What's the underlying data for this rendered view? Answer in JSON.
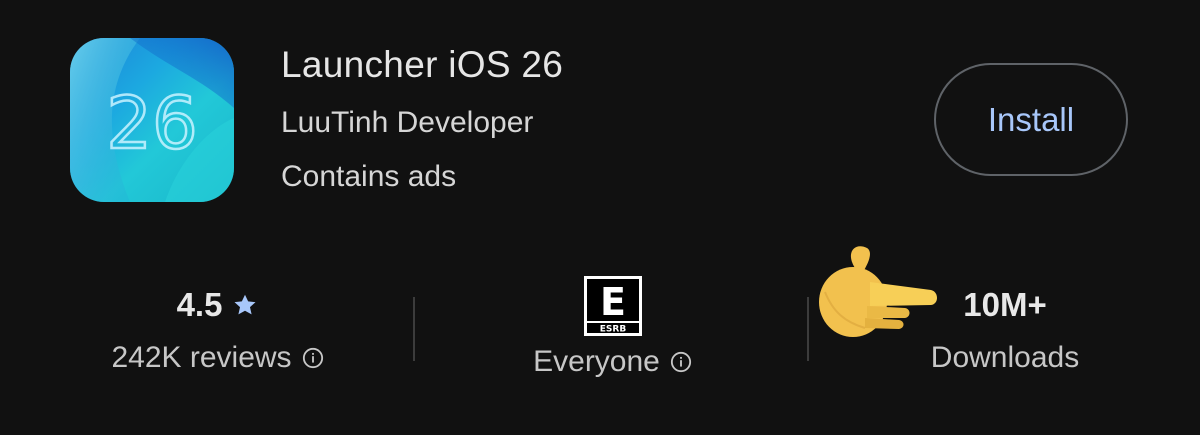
{
  "app": {
    "title": "Launcher iOS 26",
    "developer": "LuuTinh Developer",
    "ads_notice": "Contains ads",
    "icon_text": "26",
    "icon_name": "app-icon"
  },
  "actions": {
    "install_label": "Install"
  },
  "stats": {
    "rating": {
      "value": "4.5",
      "label": "242K reviews",
      "icon": "star-icon",
      "info_icon": "info-icon"
    },
    "content_rating": {
      "badge_letter": "E",
      "badge_brand": "ESRB",
      "label": "Everyone",
      "info_icon": "info-icon"
    },
    "downloads": {
      "value": "10M+",
      "label": "Downloads"
    }
  },
  "emoji": {
    "name": "pointing-hand-icon"
  },
  "colors": {
    "background": "#111111",
    "accent": "#a8c7fa",
    "button_border": "#5f6368",
    "text": "#e3e3e3"
  }
}
